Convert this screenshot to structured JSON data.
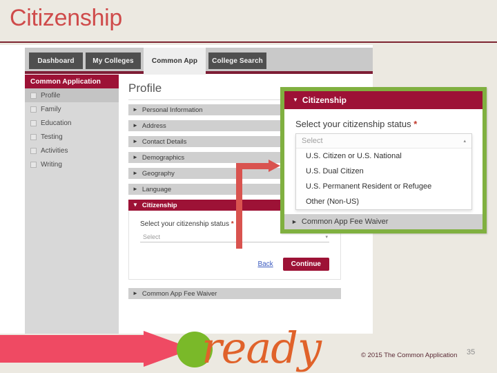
{
  "slide": {
    "title": "Citizenship",
    "page_number": "35",
    "copyright": "© 2015 The Common Application",
    "logo_word": "ready",
    "accent_crimson": "#9d1236",
    "accent_title_red": "#cf4b4b",
    "callout_border_green": "#80b040",
    "arrow_red": "#d9534f",
    "logo_green": "#7ab929",
    "logo_orange": "#e0622a",
    "background": "#ece9e1"
  },
  "app": {
    "tabs": [
      {
        "label": "Dashboard",
        "active": false
      },
      {
        "label": "My Colleges",
        "active": false
      },
      {
        "label": "Common App",
        "active": true
      },
      {
        "label": "College Search",
        "active": false
      }
    ],
    "sidebar": {
      "header": "Common Application",
      "items": [
        {
          "label": "Profile",
          "active": true
        },
        {
          "label": "Family",
          "active": false
        },
        {
          "label": "Education",
          "active": false
        },
        {
          "label": "Testing",
          "active": false
        },
        {
          "label": "Activities",
          "active": false
        },
        {
          "label": "Writing",
          "active": false
        }
      ]
    },
    "main": {
      "title": "Profile",
      "sections": [
        {
          "label": "Personal Information",
          "open": false
        },
        {
          "label": "Address",
          "open": false
        },
        {
          "label": "Contact Details",
          "open": false
        },
        {
          "label": "Demographics",
          "open": false
        },
        {
          "label": "Geography",
          "open": false
        },
        {
          "label": "Language",
          "open": false
        },
        {
          "label": "Citizenship",
          "open": true
        }
      ],
      "fee_waiver_section": "Common App Fee Waiver",
      "citizenship_form": {
        "field_label": "Select your citizenship status",
        "required_marker": "*",
        "select_value": "Select",
        "caret_icon": "▾",
        "back_link": "Back",
        "continue_button": "Continue"
      }
    }
  },
  "callout": {
    "header": "Citizenship",
    "header_caret": "▼",
    "field_label": "Select your citizenship status",
    "required_marker": "*",
    "select_value": "Select",
    "caret_icon": "▴",
    "options": [
      "U.S. Citizen or U.S. National",
      "U.S. Dual Citizen",
      "U.S. Permanent Resident or Refugee",
      "Other (Non-US)"
    ],
    "footer_section": "Common App Fee Waiver",
    "footer_caret": "►"
  },
  "icons": {
    "collapsed_caret": "►",
    "expanded_caret": "▼"
  }
}
